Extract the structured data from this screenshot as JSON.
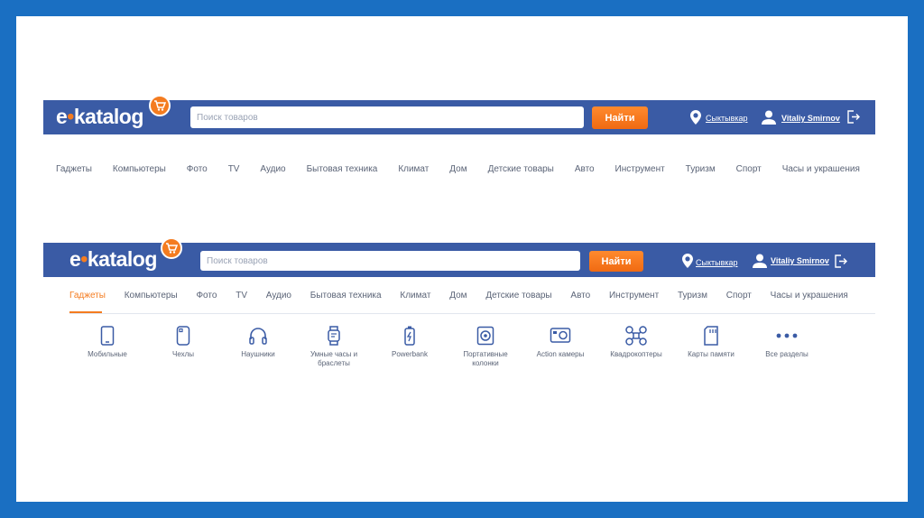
{
  "brand": {
    "logo_prefix": "e",
    "logo_dot": "•",
    "logo_rest": "katalog"
  },
  "header": {
    "search_placeholder": "Поиск товаров",
    "search_button": "Найти",
    "city": "Сыктывкар",
    "user": "Vitaliy Smirnov"
  },
  "nav": {
    "items": [
      "Гаджеты",
      "Компьютеры",
      "Фото",
      "TV",
      "Аудио",
      "Бытовая техника",
      "Климат",
      "Дом",
      "Детские товары",
      "Авто",
      "Инструмент",
      "Туризм",
      "Спорт",
      "Часы и украшения"
    ],
    "active_index_second_bar": 0
  },
  "subcategories": [
    {
      "label": "Мобильные",
      "icon": "smartphone-icon"
    },
    {
      "label": "Чехлы",
      "icon": "phone-case-icon"
    },
    {
      "label": "Наушники",
      "icon": "headphones-icon"
    },
    {
      "label": "Умные часы и браслеты",
      "icon": "smartwatch-icon"
    },
    {
      "label": "Powerbank",
      "icon": "battery-icon"
    },
    {
      "label": "Портативные колонки",
      "icon": "speaker-icon"
    },
    {
      "label": "Action камеры",
      "icon": "action-camera-icon"
    },
    {
      "label": "Квадрокоптеры",
      "icon": "drone-icon"
    },
    {
      "label": "Карты памяти",
      "icon": "memory-card-icon"
    },
    {
      "label": "Все разделы",
      "icon": "more-dots-icon"
    }
  ],
  "colors": {
    "frame": "#1a6fc2",
    "header": "#3a5ba5",
    "accent": "#f47c20",
    "nav_text": "#5b6477",
    "icon": "#3a5ba5"
  }
}
